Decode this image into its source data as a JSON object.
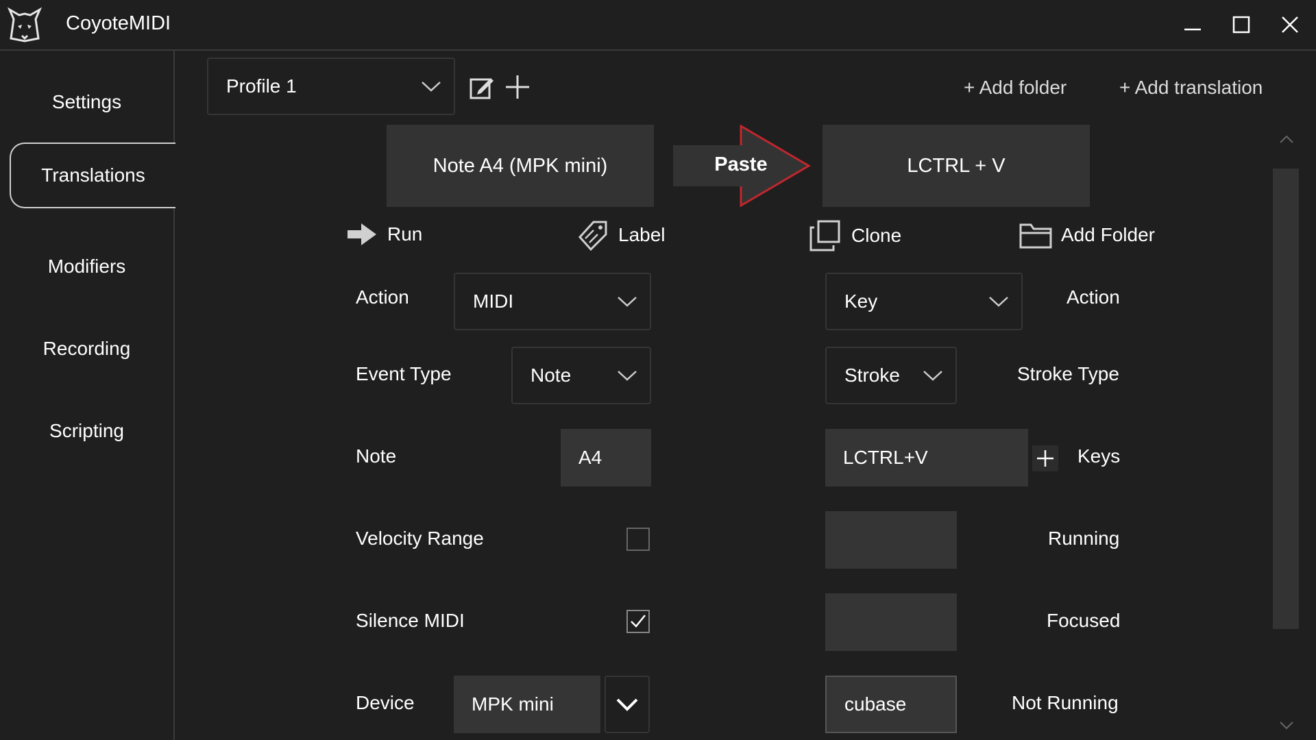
{
  "app": {
    "title": "CoyoteMIDI",
    "logo_icon": "coyote-logo-icon"
  },
  "window_controls": [
    "minimize-icon",
    "maximize-icon",
    "close-icon"
  ],
  "sidebar": {
    "items": [
      {
        "label": "Settings",
        "active": false
      },
      {
        "label": "Translations",
        "active": true
      },
      {
        "label": "Modifiers",
        "active": false
      },
      {
        "label": "Recording",
        "active": false
      },
      {
        "label": "Scripting",
        "active": false
      }
    ]
  },
  "toolbar": {
    "profile_selected": "Profile 1",
    "add_folder": "+ Add folder",
    "add_translation": "+ Add translation"
  },
  "translation": {
    "input": "Note A4 (MPK mini)",
    "name": "Paste",
    "output": "LCTRL + V"
  },
  "actions": {
    "run": "Run",
    "label": "Label",
    "clone": "Clone",
    "add_folder": "Add Folder"
  },
  "left_panel": {
    "action_label": "Action",
    "action_value": "MIDI",
    "event_type_label": "Event Type",
    "event_type_value": "Note",
    "note_label": "Note",
    "note_value": "A4",
    "velocity_range_label": "Velocity Range",
    "velocity_range_checked": false,
    "silence_midi_label": "Silence MIDI",
    "silence_midi_checked": true,
    "device_label": "Device",
    "device_value": "MPK mini"
  },
  "right_panel": {
    "action_label": "Action",
    "action_value": "Key",
    "stroke_type_label": "Stroke Type",
    "stroke_type_value": "Stroke",
    "keys_label": "Keys",
    "keys_value": "LCTRL+V",
    "running_label": "Running",
    "running_value": "",
    "focused_label": "Focused",
    "focused_value": "",
    "not_running_label": "Not Running",
    "not_running_value": "cubase"
  },
  "colors": {
    "background": "#1f1f1f",
    "panel": "#333333",
    "arrow_outline": "#c0272d"
  }
}
